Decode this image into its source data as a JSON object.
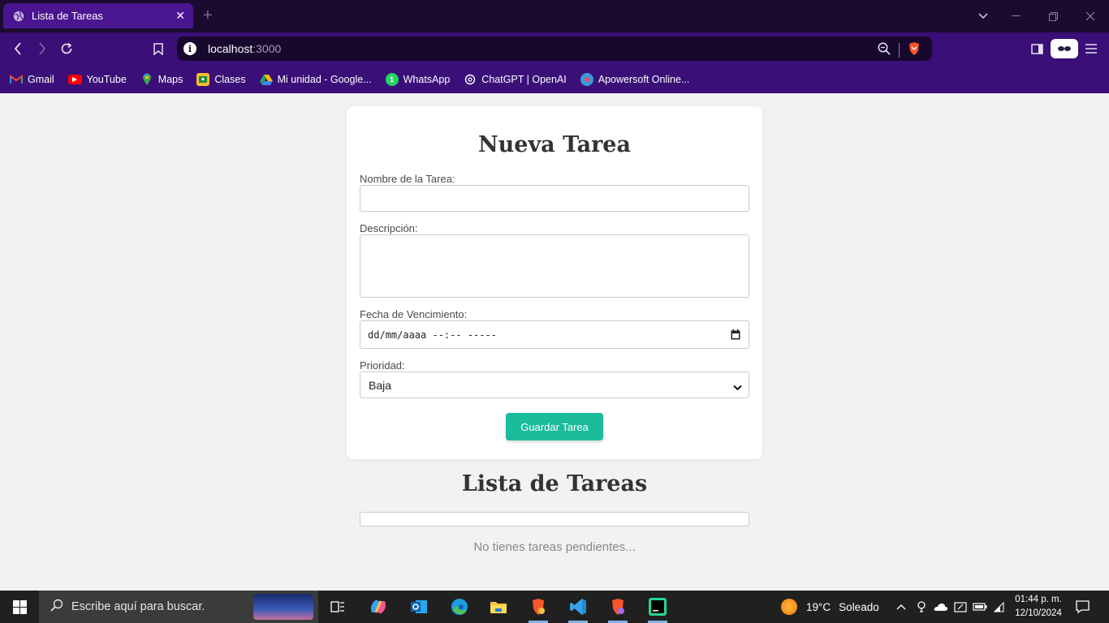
{
  "browser": {
    "tab_title": "Lista de Tareas",
    "url_host": "localhost",
    "url_port": ":3000",
    "bookmarks": [
      {
        "label": "Gmail",
        "icon": "gmail-icon"
      },
      {
        "label": "YouTube",
        "icon": "youtube-icon"
      },
      {
        "label": "Maps",
        "icon": "maps-icon"
      },
      {
        "label": "Clases",
        "icon": "classroom-icon"
      },
      {
        "label": "Mi unidad - Google...",
        "icon": "drive-icon"
      },
      {
        "label": "WhatsApp",
        "icon": "whatsapp-icon"
      },
      {
        "label": "ChatGPT | OpenAI",
        "icon": "openai-icon"
      },
      {
        "label": "Apowersoft Online...",
        "icon": "apowersoft-icon"
      }
    ]
  },
  "form": {
    "title": "Nueva Tarea",
    "name_label": "Nombre de la Tarea:",
    "name_value": "",
    "description_label": "Descripción:",
    "description_value": "",
    "due_label": "Fecha de Vencimiento:",
    "due_placeholder": "dd/mm/aaaa --:-- -----",
    "priority_label": "Prioridad:",
    "priority_value": "Baja",
    "save_label": "Guardar Tarea"
  },
  "list": {
    "title": "Lista de Tareas",
    "empty_text": "No tienes tareas pendientes..."
  },
  "taskbar": {
    "search_placeholder": "Escribe aquí para buscar.",
    "weather_temp": "19°C",
    "weather_text": "Soleado",
    "time": "01:44 p. m.",
    "date": "12/10/2024"
  },
  "colors": {
    "tab_active": "#4a1590",
    "toolbar": "#3a0f78",
    "button": "#1abc9c"
  }
}
